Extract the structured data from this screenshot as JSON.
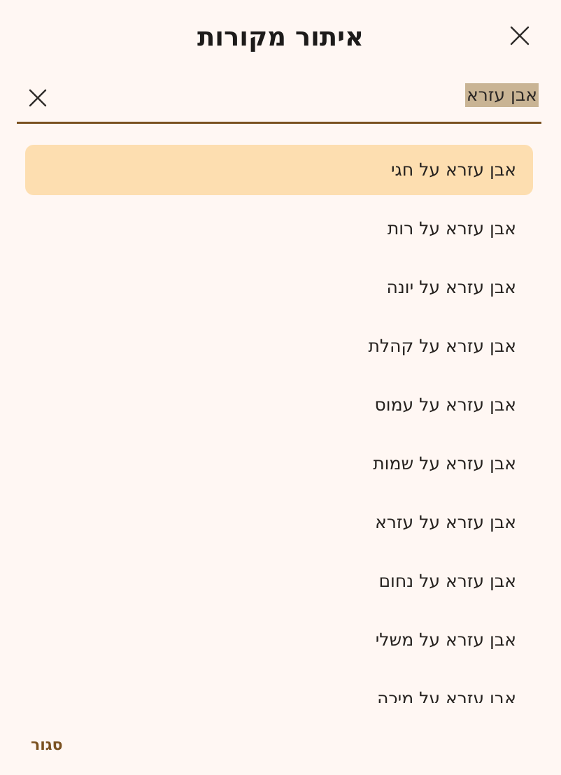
{
  "dialog": {
    "title": "איתור מקורות",
    "close_label": "סגור"
  },
  "search": {
    "value": "אבן עזרא",
    "placeholder": ""
  },
  "results": [
    "אבן עזרא על חגי",
    "אבן עזרא על רות",
    "אבן עזרא על יונה",
    "אבן עזרא על קהלת",
    "אבן עזרא על עמוס",
    "אבן עזרא על שמות",
    "אבן עזרא על עזרא",
    "אבן עזרא על נחום",
    "אבן עזרא על משלי",
    "אבן עזרא על מיכה"
  ],
  "selected_index": 0,
  "colors": {
    "background": "#fff7f3",
    "accent": "#7a5120",
    "selected_bg": "#fddeb0",
    "search_highlight": "#c9b494"
  }
}
